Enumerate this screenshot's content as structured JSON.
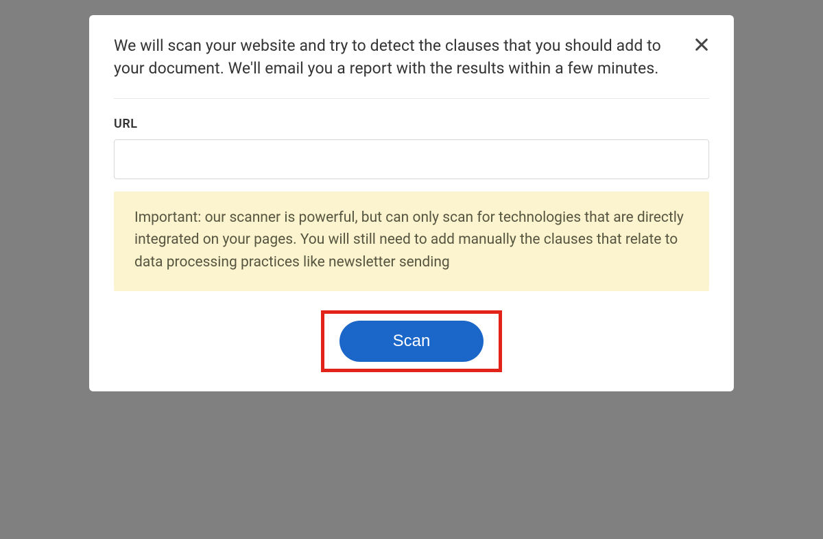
{
  "modal": {
    "description": "We will scan your website and try to detect the clauses that you should add to your document. We'll email you a report with the results within a few minutes.",
    "url_label": "URL",
    "url_value": "",
    "notice": "Important: our scanner is powerful, but can only scan for technologies that are directly integrated on your pages. You will still need to add manually the clauses that relate to data processing practices like newsletter sending",
    "scan_label": "Scan"
  }
}
